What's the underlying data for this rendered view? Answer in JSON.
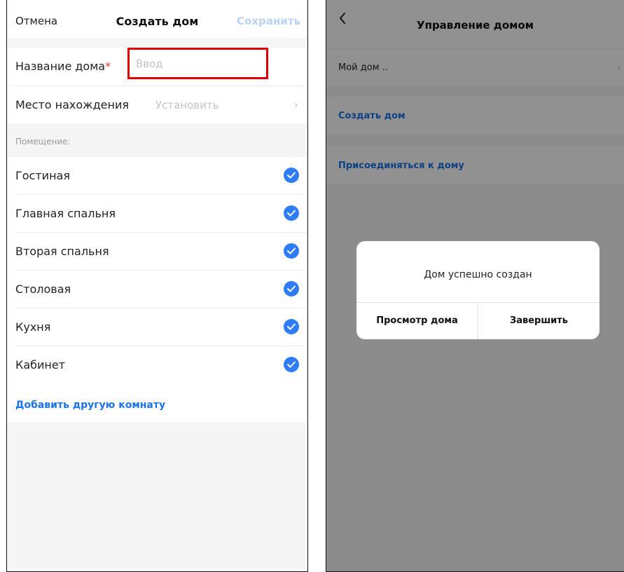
{
  "create_home": {
    "cancel_label": "Отмена",
    "title": "Создать дом",
    "save_label": "Сохранить",
    "name_field": {
      "label": "Название дома",
      "required_mark": "*",
      "placeholder": "Ввод",
      "value": ""
    },
    "location_field": {
      "label": "Место нахождения",
      "value": "Установить"
    },
    "rooms_section_label": "Помещение:",
    "rooms": [
      {
        "label": "Гостиная",
        "checked": true
      },
      {
        "label": "Главная спальня",
        "checked": true
      },
      {
        "label": "Вторая спальня",
        "checked": true
      },
      {
        "label": "Столовая",
        "checked": true
      },
      {
        "label": "Кухня",
        "checked": true
      },
      {
        "label": "Кабинет",
        "checked": true
      }
    ],
    "add_room_label": "Добавить другую комнату"
  },
  "manage_home": {
    "title": "Управление домом",
    "home_item": "Мой дом ..",
    "create_home_link": "Создать дом",
    "join_home_link": "Присоединяться к дому"
  },
  "dialog": {
    "message": "Дом успешно создан",
    "view_button": "Просмотр дома",
    "finish_button": "Завершить"
  },
  "colors": {
    "accent_blue": "#1a73e8",
    "check_blue": "#2f7df6",
    "required_red": "#e53935",
    "highlight_frame": "#e00000",
    "save_disabled": "#b9d3f7"
  },
  "icons": [
    "checkmark-icon",
    "chevron-right-icon",
    "back-arrow-icon"
  ]
}
